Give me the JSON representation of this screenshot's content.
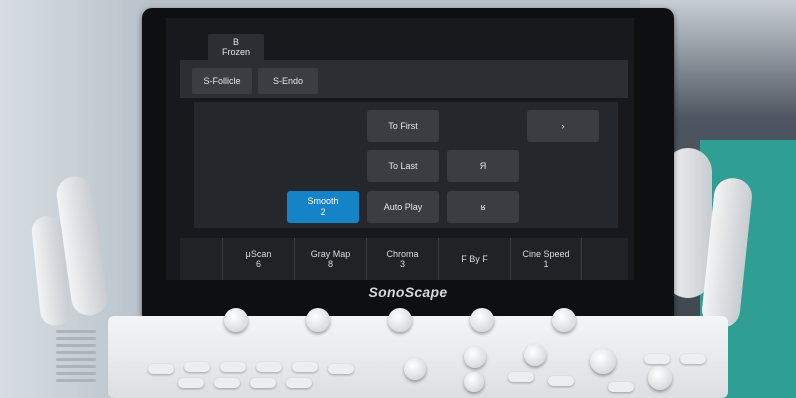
{
  "status_tab": {
    "line1": "B",
    "line2": "Frozen"
  },
  "presets": [
    {
      "label": "S-Follicle"
    },
    {
      "label": "S-Endo"
    }
  ],
  "controls": {
    "to_first": "To First",
    "to_last": "To Last",
    "auto_play": "Auto Play",
    "next": "›",
    "prev_frame": "Я",
    "prev_frame_alt": "ʁ",
    "smooth_label": "Smooth",
    "smooth_value": "2"
  },
  "soft_keys": [
    {
      "label": "μScan",
      "value": "6"
    },
    {
      "label": "Gray Map",
      "value": "8"
    },
    {
      "label": "Chroma",
      "value": "3"
    },
    {
      "label": "F By F",
      "value": ""
    },
    {
      "label": "Cine Speed",
      "value": "1"
    }
  ],
  "brand": "SonoScape",
  "colors": {
    "active_button": "#1583c7",
    "button": "#3a3d42",
    "screen": "#17191c"
  }
}
